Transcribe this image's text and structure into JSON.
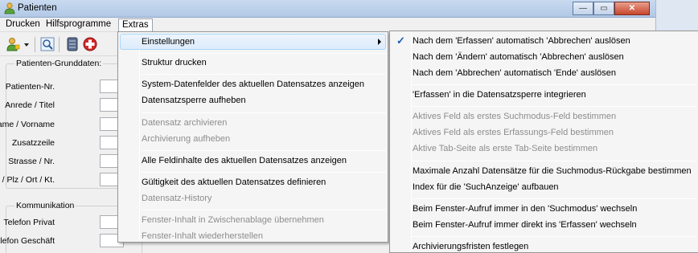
{
  "window": {
    "title": "Patienten",
    "buttons": {
      "minimize": "—",
      "maximize": "▭",
      "close": "✕"
    }
  },
  "menubar": {
    "items": [
      {
        "label": "Drucken"
      },
      {
        "label": "Hilfsprogramme"
      },
      {
        "label": "Extras"
      }
    ]
  },
  "toolbar": {
    "icons": [
      "user-add-icon",
      "dropdown-arrow-icon",
      "search-icon",
      "database-icon",
      "medical-cross-icon"
    ]
  },
  "form": {
    "group1_title": "Patienten-Grunddaten:",
    "fields1": [
      {
        "label": "Patienten-Nr."
      },
      {
        "label": "Anrede / Titel"
      },
      {
        "label": "Name / Vorname"
      },
      {
        "label": "Zusatzzeile"
      },
      {
        "label": "Strasse / Nr."
      },
      {
        "label": "Land / Plz / Ort / Kt."
      }
    ],
    "group2_title": "Kommunikation",
    "fields2": [
      {
        "label": "Telefon Privat"
      },
      {
        "label": "Telefon Geschäft"
      }
    ]
  },
  "extras_menu": {
    "items": [
      {
        "label": "Einstellungen",
        "disabled": false
      },
      {
        "label": "Struktur drucken",
        "disabled": false
      },
      {
        "label": "System-Datenfelder des aktuellen Datensatzes anzeigen",
        "disabled": false
      },
      {
        "label": "Datensatzsperre aufheben",
        "disabled": false
      },
      {
        "label": "Datensatz archivieren",
        "disabled": true
      },
      {
        "label": "Archivierung aufheben",
        "disabled": true
      },
      {
        "label": "Alle Feldinhalte des aktuellen Datensatzes anzeigen",
        "disabled": false
      },
      {
        "label": "Gültigkeit des aktuellen Datensatzes definieren",
        "disabled": false
      },
      {
        "label": "Datensatz-History",
        "disabled": true
      },
      {
        "label": "Fenster-Inhalt in Zwischenablage übernehmen",
        "disabled": true
      },
      {
        "label": "Fenster-Inhalt wiederherstellen",
        "disabled": true
      }
    ]
  },
  "settings_submenu": {
    "items": [
      {
        "label": "Nach dem 'Erfassen' automatisch 'Abbrechen' auslösen",
        "checked": true,
        "disabled": false
      },
      {
        "label": "Nach dem 'Ändern' automatisch 'Abbrechen' auslösen",
        "checked": false,
        "disabled": false
      },
      {
        "label": "Nach dem 'Abbrechen' automatisch 'Ende' auslösen",
        "checked": false,
        "disabled": false
      },
      {
        "label": "'Erfassen' in die Datensatzsperre integrieren",
        "checked": false,
        "disabled": false
      },
      {
        "label": "Aktives Feld als erstes Suchmodus-Feld bestimmen",
        "checked": false,
        "disabled": true
      },
      {
        "label": "Aktives Feld als erstes Erfassungs-Feld bestimmen",
        "checked": false,
        "disabled": true
      },
      {
        "label": "Aktive Tab-Seite als erste Tab-Seite bestimmen",
        "checked": false,
        "disabled": true
      },
      {
        "label": "Maximale Anzahl Datensätze für die Suchmodus-Rückgabe bestimmen",
        "checked": false,
        "disabled": false
      },
      {
        "label": "Index für die 'SuchAnzeige' aufbauen",
        "checked": false,
        "disabled": false
      },
      {
        "label": "Beim Fenster-Aufruf immer in den 'Suchmodus' wechseln",
        "checked": false,
        "disabled": false
      },
      {
        "label": "Beim Fenster-Aufruf immer direkt ins 'Erfassen' wechseln",
        "checked": false,
        "disabled": false
      },
      {
        "label": "Archivierungsfristen festlegen",
        "checked": false,
        "disabled": false
      }
    ],
    "check_glyph": "✓"
  }
}
